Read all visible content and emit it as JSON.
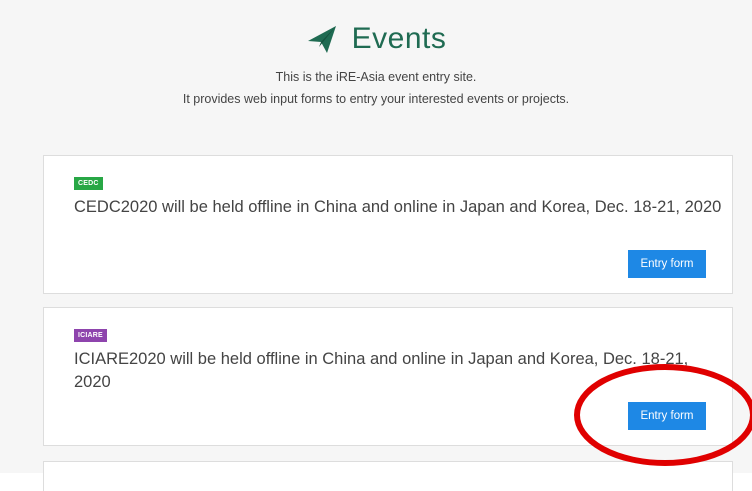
{
  "header": {
    "logo_icon": "paper-plane-icon",
    "title": "Events",
    "subtitle_line1": "This is the iRE-Asia event entry site.",
    "subtitle_line2": "It provides web input forms to entry your interested events or projects."
  },
  "events": [
    {
      "badge": "CEDC",
      "badge_color": "#28a745",
      "description": "CEDC2020 will be held offline in China and online in Japan and Korea, Dec. 18-21, 2020",
      "button_label": "Entry form"
    },
    {
      "badge": "ICIARE",
      "badge_color": "#8e44ad",
      "description": "ICIARE2020 will be held offline in China and online in Japan and Korea, Dec. 18-21, 2020",
      "button_label": "Entry form"
    }
  ],
  "colors": {
    "accent": "#1f6b52",
    "button": "#1e88e5",
    "annotation": "#e00000"
  }
}
